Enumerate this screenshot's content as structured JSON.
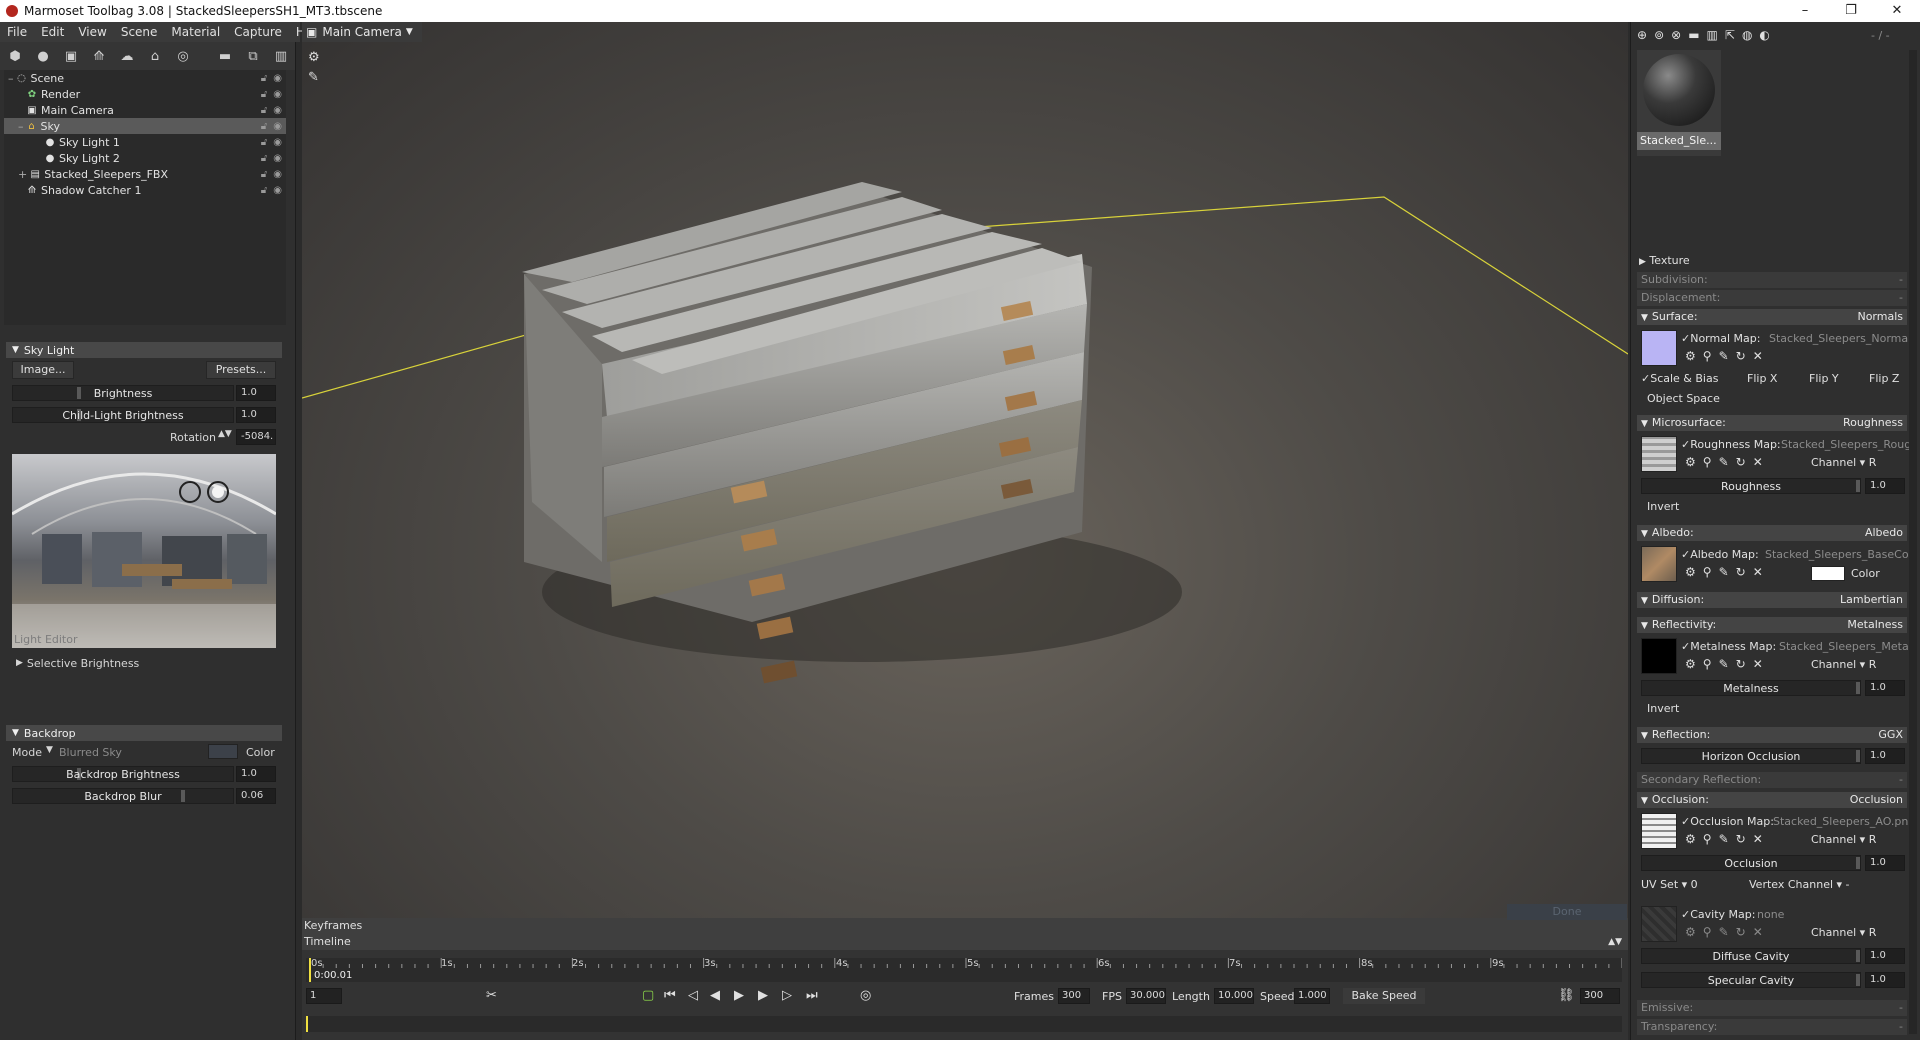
{
  "window": {
    "title": "Marmoset Toolbag 3.08 | StackedSleepersSH1_MT3.tbscene",
    "minimize": "–",
    "maximize": "❐",
    "close": "✕"
  },
  "menu": [
    "File",
    "Edit",
    "View",
    "Scene",
    "Material",
    "Capture",
    "Help"
  ],
  "scene_tree": [
    {
      "label": "Scene",
      "indent": 0,
      "icon": "scene-icon"
    },
    {
      "label": "Render",
      "indent": 1,
      "icon": "render-icon"
    },
    {
      "label": "Main Camera",
      "indent": 1,
      "icon": "camera-icon"
    },
    {
      "label": "Sky",
      "indent": 1,
      "icon": "sky-icon",
      "selected": true
    },
    {
      "label": "Sky Light 1",
      "indent": 2,
      "icon": "light-icon"
    },
    {
      "label": "Sky Light 2",
      "indent": 2,
      "icon": "light-icon"
    },
    {
      "label": "Stacked_Sleepers_FBX",
      "indent": 1,
      "icon": "mesh-icon"
    },
    {
      "label": "Shadow Catcher 1",
      "indent": 1,
      "icon": "shadow-catcher-icon"
    }
  ],
  "sky_light": {
    "header": "Sky Light",
    "image_button": "Image...",
    "presets_button": "Presets...",
    "brightness_label": "Brightness",
    "brightness_value": "1.0",
    "child_brightness_label": "Child-Light Brightness",
    "child_brightness_value": "1.0",
    "rotation_label": "Rotation",
    "rotation_value": "-5084.",
    "light_editor_label": "Light Editor",
    "selective_brightness": "Selective Brightness"
  },
  "backdrop": {
    "header": "Backdrop",
    "mode_label": "Mode",
    "mode_value": "Blurred Sky",
    "color_label": "Color",
    "brightness_label": "Backdrop Brightness",
    "brightness_value": "1.0",
    "blur_label": "Backdrop Blur",
    "blur_value": "0.06"
  },
  "viewport": {
    "camera_label": "Main Camera"
  },
  "timeline": {
    "keyframes_label": "Keyframes",
    "timeline_label": "Timeline",
    "ticks": [
      "0s",
      "1s",
      "2s",
      "3s",
      "4s",
      "5s",
      "6s",
      "7s",
      "8s",
      "9s"
    ],
    "current_time": "0:00.01",
    "frame_field": "1",
    "frames_label": "Frames",
    "frames_value": "300",
    "fps_label": "FPS",
    "fps_value": "30.000",
    "length_label": "Length",
    "length_value": "10.000",
    "speed_label": "Speed",
    "speed_value": "1.000",
    "bake_speed": "Bake Speed",
    "end_frame": "300"
  },
  "material": {
    "thumb_label": "Stacked_Sle...",
    "top_right_label": "- / -",
    "texture": "Texture",
    "subdivision": "Subdivision:",
    "displacement": "Displacement:",
    "dash": "-",
    "surface": {
      "label": "Surface:",
      "value": "Normals",
      "map": "Normal Map:",
      "file": "Stacked_Sleepers_Normal..."
    },
    "scale_bias": "Scale & Bias",
    "flip_x": "Flip X",
    "flip_y": "Flip Y",
    "flip_z": "Flip Z",
    "object_space": "Object Space",
    "microsurface": {
      "label": "Microsurface:",
      "value": "Roughness",
      "map": "Roughness Map:",
      "file": "Stacked_Sleepers_Roug..."
    },
    "channel": "Channel",
    "channel_r": "R",
    "roughness_label": "Roughness",
    "roughness_value": "1.0",
    "invert": "Invert",
    "albedo": {
      "label": "Albedo:",
      "value": "Albedo",
      "map": "Albedo Map:",
      "file": "Stacked_Sleepers_BaseColo..."
    },
    "color_label": "Color",
    "diffusion": {
      "label": "Diffusion:",
      "value": "Lambertian"
    },
    "reflectivity": {
      "label": "Reflectivity:",
      "value": "Metalness",
      "map": "Metalness Map:",
      "file": "Stacked_Sleepers_Metal..."
    },
    "metalness_label": "Metalness",
    "metalness_value": "1.0",
    "reflection": {
      "label": "Reflection:",
      "value": "GGX"
    },
    "horizon_label": "Horizon Occlusion",
    "horizon_value": "1.0",
    "secondary_reflection": "Secondary Reflection:",
    "occlusion": {
      "label": "Occlusion:",
      "value": "Occlusion",
      "map": "Occlusion Map:",
      "file": "Stacked_Sleepers_AO.pn..."
    },
    "occlusion_label": "Occlusion",
    "occlusion_value": "1.0",
    "uv_set": "UV Set",
    "uv_set_value": "0",
    "vertex_channel": "Vertex Channel",
    "cavity_map": "Cavity Map:",
    "cavity_file": "none",
    "diffuse_cavity": "Diffuse Cavity",
    "diffuse_cavity_value": "1.0",
    "specular_cavity": "Specular Cavity",
    "specular_cavity_value": "1.0",
    "emissive": "Emissive:",
    "transparency": "Transparency:",
    "ghost_button": "Done"
  },
  "colors": {
    "ground_line": "#d8d23a",
    "normal_swatch": "#b9b4f4",
    "albedo_swatch": "#ffffff"
  }
}
